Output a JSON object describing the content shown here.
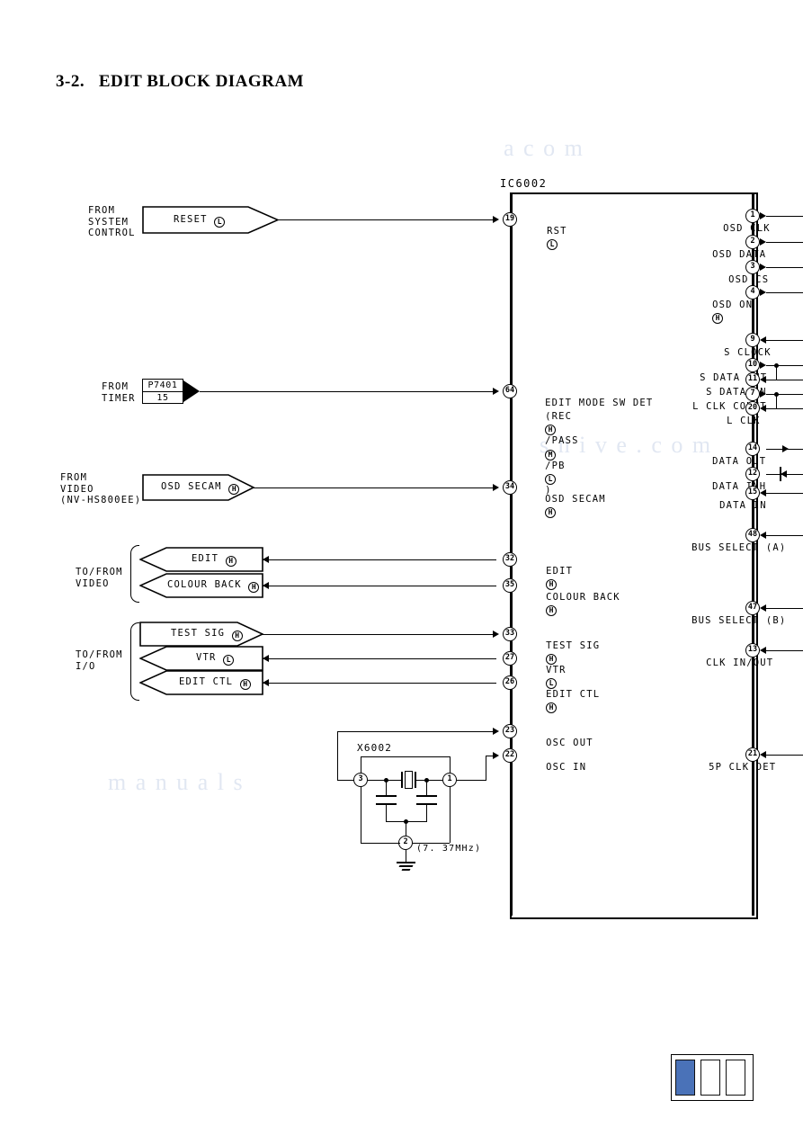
{
  "document": {
    "section_number": "3-2.",
    "title": "EDIT BLOCK DIAGRAM"
  },
  "ic": {
    "name": "IC6002"
  },
  "crystal": {
    "name": "X6002",
    "frequency": "(7. 37MHz)",
    "pin1": "1",
    "pin2": "2",
    "pin3": "3"
  },
  "connector": {
    "name": "P7401",
    "pin": "15"
  },
  "source_labels": {
    "system_control": "FROM\nSYSTEM\nCONTROL",
    "timer": "FROM\nTIMER",
    "video": "FROM\nVIDEO\n(NV-HS800EE)",
    "to_from_video": "TO/FROM\nVIDEO",
    "to_from_io": "TO/FROM\nI/O"
  },
  "flags": [
    {
      "text": "RESET",
      "level": "L",
      "dir": "right"
    },
    {
      "text": "OSD SECAM",
      "level": "H",
      "dir": "right"
    },
    {
      "text": "EDIT",
      "level": "H",
      "dir": "left"
    },
    {
      "text": "COLOUR BACK",
      "level": "H",
      "dir": "left"
    },
    {
      "text": "TEST SIG",
      "level": "H",
      "dir": "right"
    },
    {
      "text": "VTR",
      "level": "L",
      "dir": "left"
    },
    {
      "text": "EDIT CTL",
      "level": "H",
      "dir": "left"
    }
  ],
  "left_pins": [
    {
      "pin": "19",
      "label": "RST",
      "level": "L",
      "sub": ""
    },
    {
      "pin": "64",
      "label": "EDIT MODE SW DET",
      "level": "",
      "sub": "(REC H /PASS M /PB L)"
    },
    {
      "pin": "34",
      "label": "OSD SECAM",
      "level": "H",
      "sub": ""
    },
    {
      "pin": "32",
      "label": "EDIT",
      "level": "H",
      "sub": ""
    },
    {
      "pin": "35",
      "label": "COLOUR BACK",
      "level": "H",
      "sub": ""
    },
    {
      "pin": "33",
      "label": "TEST SIG",
      "level": "H",
      "sub": ""
    },
    {
      "pin": "27",
      "label": "VTR",
      "level": "L",
      "sub": ""
    },
    {
      "pin": "26",
      "label": "EDIT CTL",
      "level": "H",
      "sub": ""
    },
    {
      "pin": "23",
      "label": "OSC OUT",
      "level": "",
      "sub": ""
    },
    {
      "pin": "22",
      "label": "OSC IN",
      "level": "",
      "sub": ""
    }
  ],
  "right_pins": [
    {
      "pin": "1",
      "label": "OSD CLK",
      "level": "",
      "dir": "out"
    },
    {
      "pin": "2",
      "label": "OSD DATA",
      "level": "",
      "dir": "out"
    },
    {
      "pin": "3",
      "label": "OSD CS",
      "level": "",
      "dir": "out"
    },
    {
      "pin": "4",
      "label": "OSD ON",
      "level": "H",
      "dir": "out"
    },
    {
      "pin": "9",
      "label": "S CLOCK",
      "level": "",
      "dir": "in"
    },
    {
      "pin": "10",
      "label": "S DATA OUT",
      "level": "",
      "dir": "out"
    },
    {
      "pin": "11",
      "label": "S DATA IN",
      "level": "",
      "dir": "in"
    },
    {
      "pin": "7",
      "label": "L CLK COUNT",
      "level": "",
      "dir": "out"
    },
    {
      "pin": "20",
      "label": "L CLK",
      "level": "",
      "dir": "in"
    },
    {
      "pin": "14",
      "label": "DATA OUT",
      "level": "",
      "dir": "out"
    },
    {
      "pin": "12",
      "label": "DATA INH",
      "level": "",
      "dir": "out"
    },
    {
      "pin": "15",
      "label": "DATA IN",
      "level": "",
      "dir": "in"
    },
    {
      "pin": "48",
      "label": "BUS SELECT (A)",
      "level": "",
      "dir": "in"
    },
    {
      "pin": "47",
      "label": "BUS SELECT (B)",
      "level": "",
      "dir": "in"
    },
    {
      "pin": "13",
      "label": "CLK IN/OUT",
      "level": "",
      "dir": "in"
    },
    {
      "pin": "21",
      "label": "5P CLK DET",
      "level": "",
      "dir": "in"
    }
  ],
  "edit_mode_detail": {
    "prefix": "(REC",
    "rec_level": "H",
    "mid1": "/PASS",
    "pass_level": "M",
    "mid2": "/PB",
    "pb_level": "L",
    "suffix": ")"
  },
  "page_indicator": {
    "accent": "#4a72b8",
    "cells": 3,
    "active_index": 0
  },
  "watermark": {
    "w1": "a c o m",
    "w2": "s h i v e . c o m",
    "w3": "m a n u a l s"
  }
}
